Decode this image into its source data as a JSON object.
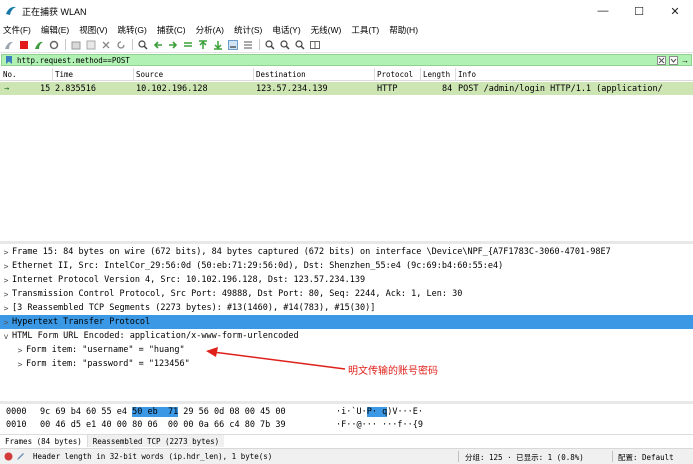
{
  "window": {
    "title": "正在捕获 WLAN",
    "min": "—",
    "max": "☐",
    "close": "✕"
  },
  "menu": [
    "文件(F)",
    "编辑(E)",
    "视图(V)",
    "跳转(G)",
    "捕获(C)",
    "分析(A)",
    "统计(S)",
    "电话(Y)",
    "无线(W)",
    "工具(T)",
    "帮助(H)"
  ],
  "filter": {
    "value": "http.request.method==POST",
    "apply_symbol": "→"
  },
  "columns": [
    "No.",
    "Time",
    "Source",
    "Destination",
    "Protocol",
    "Length",
    "Info"
  ],
  "packet": {
    "marker": "→",
    "no": "15",
    "time": "2.835516",
    "source": "10.102.196.128",
    "destination": "123.57.234.139",
    "protocol": "HTTP",
    "length": "84",
    "info": "POST /admin/login HTTP/1.1  (application/"
  },
  "details": [
    {
      "text": "Frame 15: 84 bytes on wire (672 bits), 84 bytes captured (672 bits) on interface \\Device\\NPF_{A7F1783C-3060-4701-98E7",
      "arrow": ">"
    },
    {
      "text": "Ethernet II, Src: IntelCor_29:56:0d (50:eb:71:29:56:0d), Dst: Shenzhen_55:e4 (9c:69:b4:60:55:e4)",
      "arrow": ">"
    },
    {
      "text": "Internet Protocol Version 4, Src: 10.102.196.128, Dst: 123.57.234.139",
      "arrow": ">"
    },
    {
      "text": "Transmission Control Protocol, Src Port: 49888, Dst Port: 80, Seq: 2244, Ack: 1, Len: 30",
      "arrow": ">"
    },
    {
      "text": "[3 Reassembled TCP Segments (2273 bytes): #13(1460), #14(783), #15(30)]",
      "arrow": ">"
    },
    {
      "text": "Hypertext Transfer Protocol",
      "arrow": ">"
    },
    {
      "text": "HTML Form URL Encoded: application/x-www-form-urlencoded",
      "arrow": "v"
    },
    {
      "text": "Form item: \"username\" = \"huang\"",
      "arrow": ">"
    },
    {
      "text": "Form item: \"password\" = \"123456\"",
      "arrow": ">"
    }
  ],
  "annotation": "明文传输的账号密码",
  "bytes": [
    {
      "offset": "0000",
      "hex_a": "9c 69 b4 60 55 e4 ",
      "hex_hl": "50 eb  71",
      "hex_b": " 29 56 0d 08 00 45 00",
      "asc_a": "·i·`U·",
      "asc_hl": "P· q",
      "asc_b": ")V···E·"
    },
    {
      "offset": "0010",
      "hex_a": "00 46 d5 e1 40 00 80 06  00 00 0a 66 c4 80 7b 39",
      "hex_hl": "",
      "hex_b": "",
      "asc_a": "·F··@··· ···f··{9",
      "asc_hl": "",
      "asc_b": ""
    }
  ],
  "byte_tabs": [
    "Frames (84 bytes)",
    "Reassembled TCP (2273 bytes)"
  ],
  "status": {
    "hint": "Header length in 32-bit words (ip.hdr_len), 1 byte(s)",
    "groups": "分组: 125 · 已显示: 1 (0.8%)",
    "profile": "配置: Default"
  }
}
